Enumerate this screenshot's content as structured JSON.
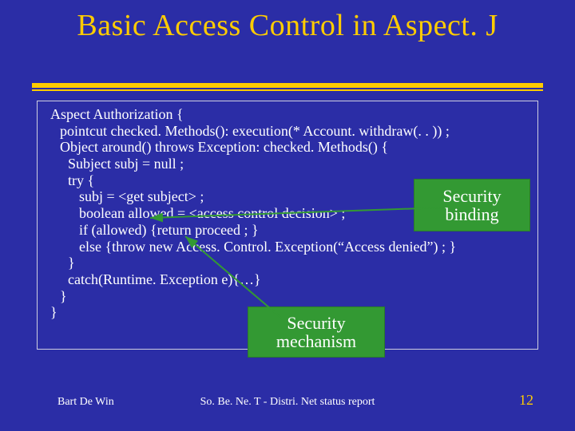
{
  "title": "Basic Access Control in Aspect. J",
  "code": {
    "l1": "Aspect Authorization {",
    "l2": "pointcut checked. Methods(): execution(* Account. withdraw(. . )) ;",
    "l3": "",
    "l4": "Object around() throws Exception: checked. Methods() {",
    "l5": "Subject subj = null ;",
    "l6": "try {",
    "l7": "subj = <get subject> ;",
    "l8": "boolean allowed = <access control decision> ;",
    "l9": "if (allowed) {return proceed ; }",
    "l10": "else {throw new Access. Control. Exception(“Access denied”) ; }",
    "l11": "}",
    "l12": "catch(Runtime. Exception e){…}",
    "l13": "}",
    "l14": "}"
  },
  "callouts": {
    "security_binding": "Security binding",
    "security_mechanism": "Security mechanism"
  },
  "colors": {
    "background": "#2b2da6",
    "accent": "#ffcc00",
    "callout_bg": "#339933",
    "arrow": "#339933"
  },
  "footer": {
    "author": "Bart De Win",
    "center": "So. Be. Ne. T - Distri. Net status report",
    "page": "12"
  }
}
